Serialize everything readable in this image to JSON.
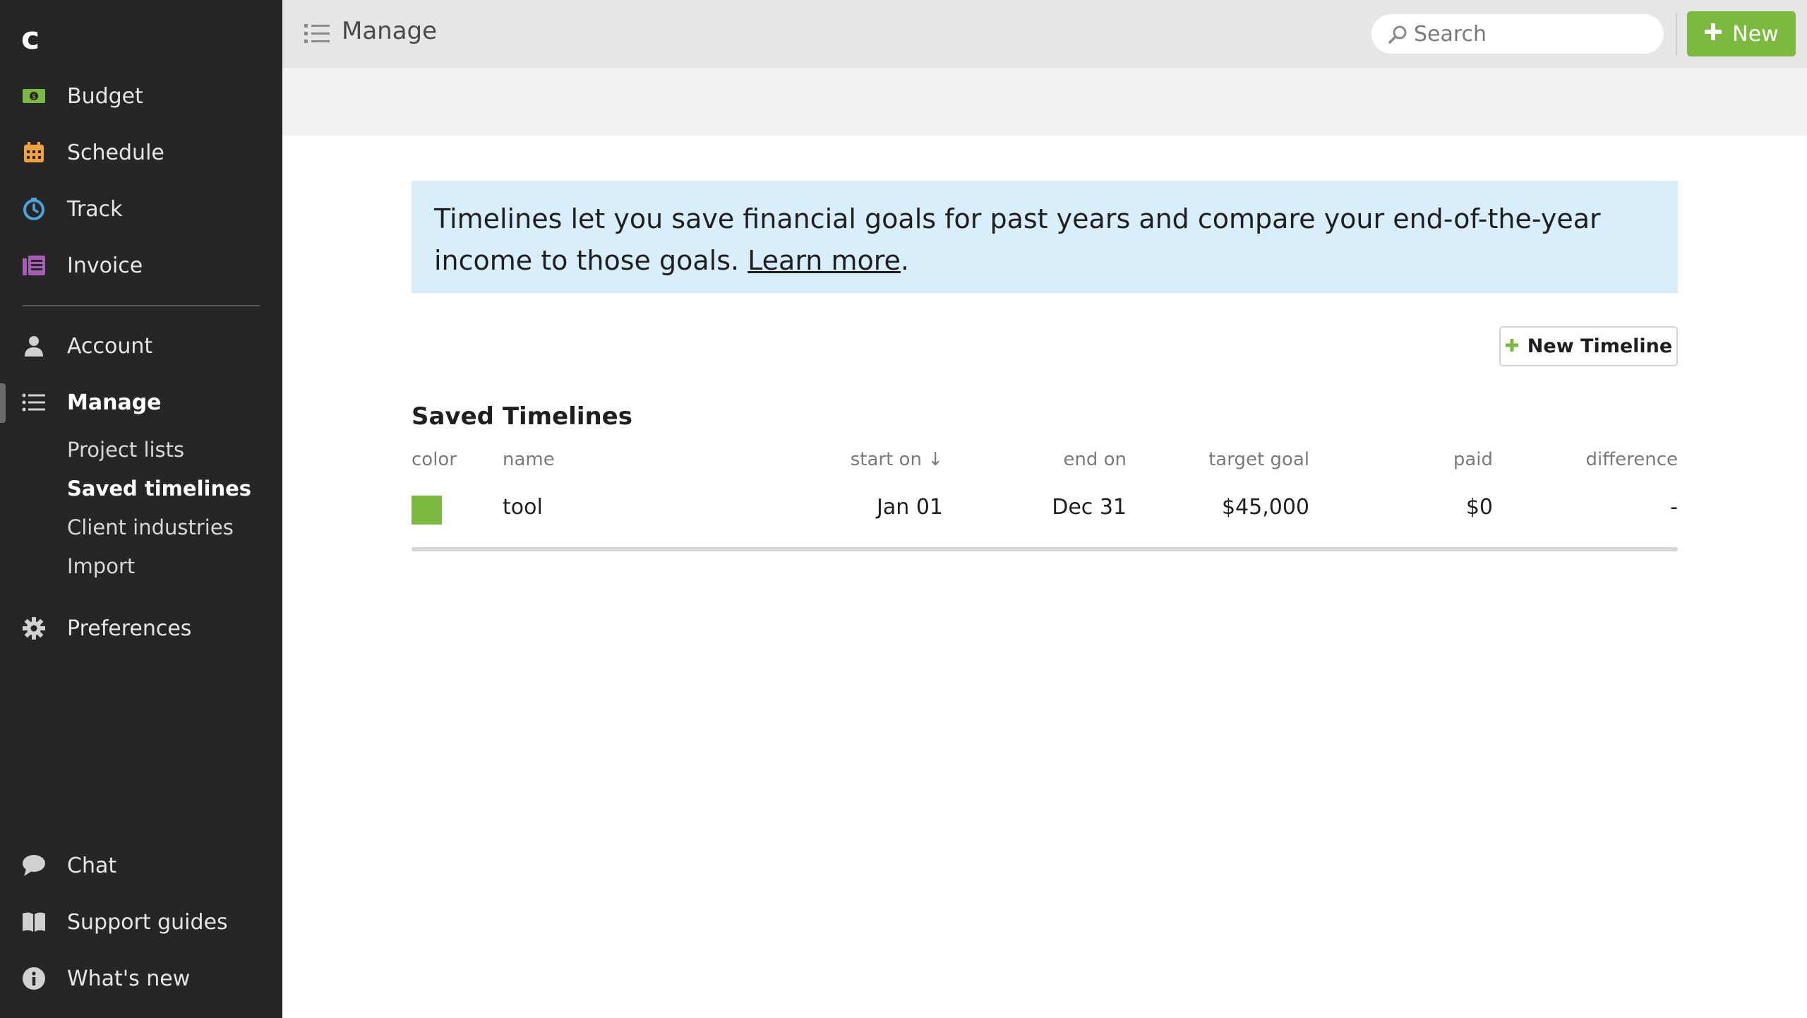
{
  "app": {
    "logo": "c"
  },
  "sidebar": {
    "nav": [
      {
        "label": "Budget",
        "icon": "budget-icon",
        "color": "#7bb93f"
      },
      {
        "label": "Schedule",
        "icon": "calendar-icon",
        "color": "#f0a33a"
      },
      {
        "label": "Track",
        "icon": "clock-icon",
        "color": "#4aa3df"
      },
      {
        "label": "Invoice",
        "icon": "invoice-icon",
        "color": "#a45fb5"
      }
    ],
    "account": {
      "label": "Account",
      "icon": "user-icon"
    },
    "manage": {
      "label": "Manage",
      "icon": "list-icon",
      "subitems": [
        "Project lists",
        "Saved timelines",
        "Client industries",
        "Import"
      ],
      "active_subitem": "Saved timelines"
    },
    "preferences": {
      "label": "Preferences",
      "icon": "gear-icon"
    },
    "bottom": [
      {
        "label": "Chat",
        "icon": "chat-icon"
      },
      {
        "label": "Support guides",
        "icon": "book-icon"
      },
      {
        "label": "What's new",
        "icon": "info-icon"
      }
    ]
  },
  "topbar": {
    "title": "Manage",
    "search_placeholder": "Search",
    "new_button": "New"
  },
  "info_banner": {
    "text": "Timelines let you save financial goals for past years and compare your end-of-the-year income to those goals.",
    "link": "Learn more",
    "suffix": "."
  },
  "new_timeline_button": "New Timeline",
  "section_title": "Saved Timelines",
  "table": {
    "columns": [
      "color",
      "name",
      "start on ↓",
      "end on",
      "target goal",
      "paid",
      "difference"
    ],
    "rows": [
      {
        "color": "#7bb93f",
        "name": "tool",
        "start_on": "Jan 01",
        "end_on": "Dec 31",
        "target_goal": "$45,000",
        "paid": "$0",
        "difference": "-"
      }
    ]
  },
  "colors": {
    "accent": "#7bb93f",
    "sidebar_bg": "#262626",
    "info_bg": "#d9eefb"
  }
}
